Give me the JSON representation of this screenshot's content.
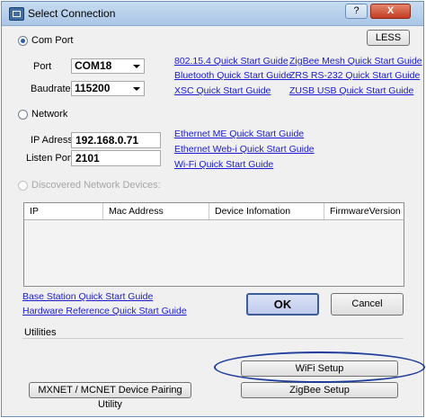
{
  "window": {
    "title": "Select Connection",
    "help_label": "?",
    "close_label": "X"
  },
  "com_port": {
    "radio_label": "Com Port",
    "less_button": "LESS",
    "port_label": "Port",
    "port_value": "COM18",
    "baudrate_label": "Baudrate",
    "baudrate_value": "115200",
    "guides": [
      "802.15.4 Quick Start Guide",
      "ZigBee Mesh Quick Start Guide",
      "Bluetooth Quick Start Guide",
      "ZRS RS-232 Quick Start Guide",
      "XSC Quick Start Guide",
      "ZUSB USB Quick Start Guide"
    ]
  },
  "network": {
    "radio_label": "Network",
    "ip_label": "IP Adress",
    "ip_value": "192.168.0.71",
    "listen_label": "Listen Port",
    "listen_value": "2101",
    "guides": [
      "Ethernet ME Quick Start Guide",
      "Ethernet Web-i Quick Start Guide",
      "Wi-Fi Quick Start Guide"
    ]
  },
  "discovered": {
    "radio_label": "Discovered Network Devices:",
    "columns": [
      "IP",
      "Mac Address",
      "Device Infomation",
      "FirmwareVersion"
    ]
  },
  "bottom_links": [
    "Base Station Quick Start Guide",
    "Hardware Reference Quick Start Guide"
  ],
  "actions": {
    "ok_label": "OK",
    "cancel_label": "Cancel"
  },
  "utilities": {
    "label": "Utilities",
    "wifi_setup": "WiFi Setup",
    "mxnet_pairing": "MXNET / MCNET Device Pairing Utility",
    "zigbee_setup": "ZigBee Setup"
  },
  "colors": {
    "link": "#1a1ad4",
    "highlight_ellipse": "#1e3d9a",
    "ok_border": "#3c5d9a"
  }
}
